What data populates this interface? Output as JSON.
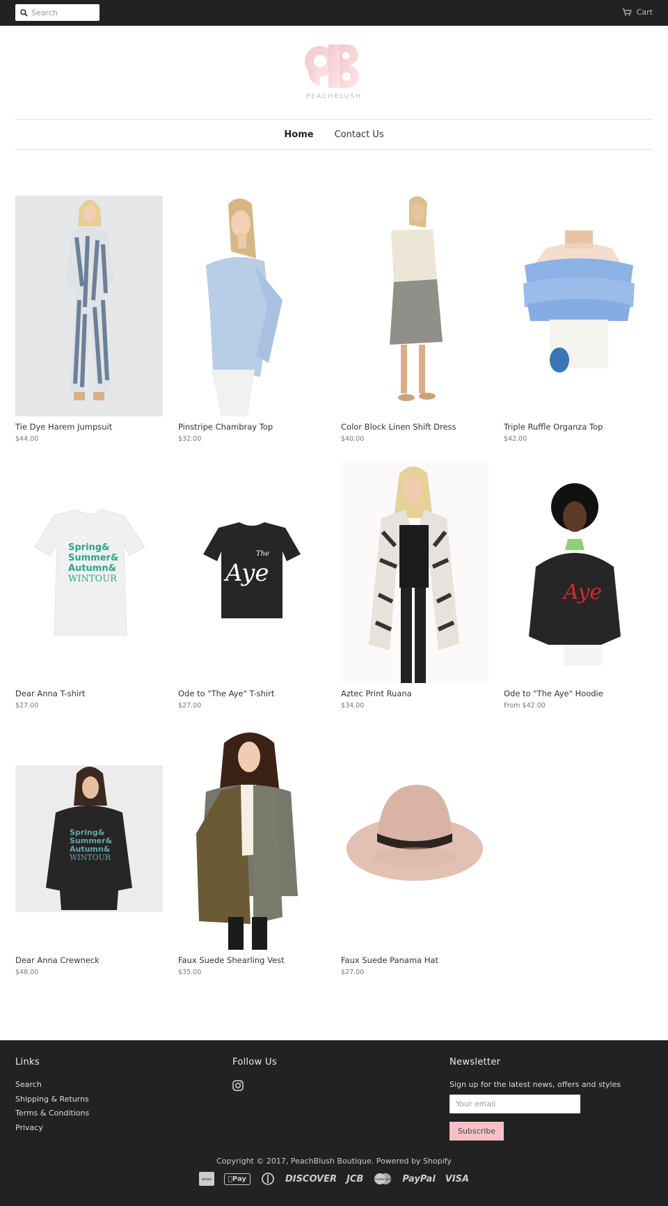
{
  "header": {
    "search_placeholder": "Search",
    "cart_label": "Cart",
    "brand_text": "PEACHBLUSH"
  },
  "nav": [
    {
      "label": "Home",
      "active": true
    },
    {
      "label": "Contact Us",
      "active": false
    }
  ],
  "products": [
    {
      "name": "Tie Dye Harem Jumpsuit",
      "price": "$44.00"
    },
    {
      "name": "Pinstripe Chambray Top",
      "price": "$32.00"
    },
    {
      "name": "Color Block Linen Shift Dress",
      "price": "$40.00"
    },
    {
      "name": "Triple Ruffle Organza Top",
      "price": "$42.00"
    },
    {
      "name": "Dear Anna T-shirt",
      "price": "$27.00"
    },
    {
      "name": "Ode to \"The Aye\" T-shirt",
      "price": "$27.00"
    },
    {
      "name": "Aztec Print Ruana",
      "price": "$34.00"
    },
    {
      "name": "Ode to \"The Aye\" Hoodie",
      "price": "From $42.00"
    },
    {
      "name": "Dear Anna Crewneck",
      "price": "$48.00"
    },
    {
      "name": "Faux Suede Shearling Vest",
      "price": "$35.00"
    },
    {
      "name": "Faux Suede Panama Hat",
      "price": "$27.00"
    }
  ],
  "tee_print": {
    "dear_anna": [
      "Spring&",
      "Summer&",
      "Autumn&",
      "WINTOUR"
    ],
    "aye_script": "Aye",
    "aye_small": "The"
  },
  "footer": {
    "links_title": "Links",
    "links": [
      "Search",
      "Shipping & Returns",
      "Terms & Conditions",
      "Privacy"
    ],
    "follow_title": "Follow Us",
    "newsletter_title": "Newsletter",
    "newsletter_text": "Sign up for the latest news, offers and styles",
    "email_placeholder": "Your email",
    "subscribe_label": "Subscribe",
    "copyright": "Copyright © 2017, PeachBlush Boutique. Powered by Shopify",
    "payments": [
      "amex",
      "Pay",
      "diners",
      "DISCOVER",
      "JCB",
      "mastercard",
      "PayPal",
      "VISA"
    ]
  },
  "colors": {
    "topbar": "#222222",
    "accent_pink": "#f6c0c4",
    "footer_bg": "#222222"
  }
}
